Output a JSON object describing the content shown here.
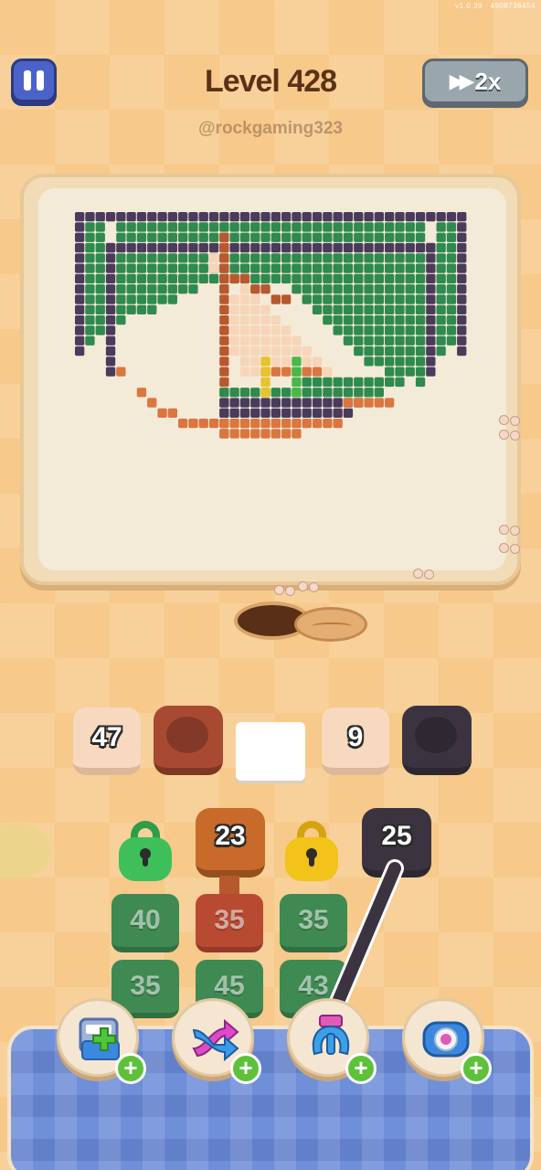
{
  "status_bar": {
    "version": "v1.0.39 · 4908736454"
  },
  "header": {
    "title": "Level 428",
    "username": "@rockgaming323",
    "speed_label": "2x"
  },
  "puzzle": {
    "palette": {
      "dark": "#4a3a5c",
      "green": "#2e8a4e",
      "rust": "#b8582e",
      "orange": "#d9773e",
      "cream": "#f6d5b8",
      "lime": "#48b848",
      "yellow": "#e6c42a"
    }
  },
  "queue": {
    "slots": [
      {
        "count": "47",
        "cannon_color": "#a84a32"
      },
      {
        "empty": true
      },
      {
        "count": "9",
        "cannon_color": "#3b3440"
      }
    ]
  },
  "shooters": {
    "top_row": [
      {
        "type": "lock",
        "color": "#3fbf5a"
      },
      {
        "type": "cannon",
        "count": "23",
        "color": "#c86a2a"
      },
      {
        "type": "lock",
        "color": "#f2c318"
      },
      {
        "type": "cannon",
        "count": "25",
        "color": "#3b3440"
      }
    ],
    "row2": [
      "40",
      "35",
      "35"
    ],
    "row3": [
      "35",
      "45",
      "43"
    ]
  },
  "boosters": [
    {
      "name": "add-slot-booster",
      "plus": "+"
    },
    {
      "name": "shuffle-booster",
      "plus": "+"
    },
    {
      "name": "claw-booster",
      "plus": "+"
    },
    {
      "name": "magnet-booster",
      "plus": "+"
    }
  ]
}
